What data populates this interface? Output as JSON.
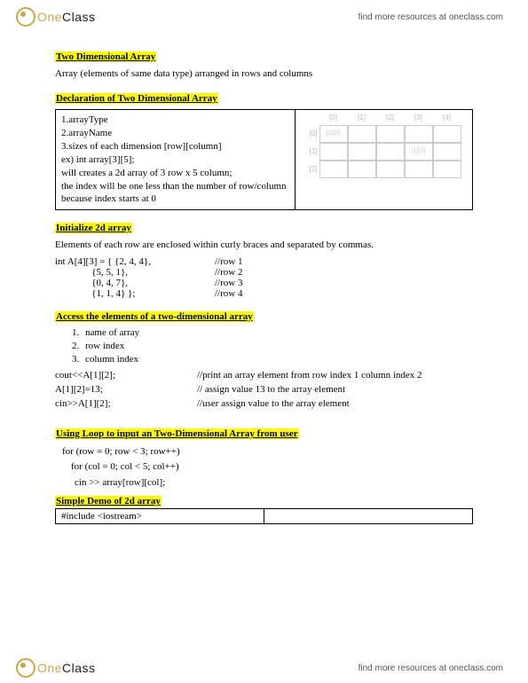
{
  "brand": {
    "one": "One",
    "class": "Class"
  },
  "find_link": "find more resources at oneclass.com",
  "s1": {
    "title": "Two Dimensional Array",
    "desc": "Array (elements of same data type) arranged in rows and columns"
  },
  "s2": {
    "title": "Declaration of Two Dimensional Array",
    "l1": "1.arrayType",
    "l2": "2.arrayName",
    "l3": "3.sizes of each dimension [row][column]",
    "l4": "ex) int array[3][5];",
    "l5": "will creates a 2d array of 3 row x 5 column;",
    "l6": "the index will be one less than the number of row/column because index starts at 0",
    "cols": [
      "[0]",
      "[1]",
      "[2]",
      "[3]",
      "[4]"
    ],
    "rows": [
      "[0]",
      "[1]",
      "[2]"
    ],
    "cell00": "[0][0]",
    "cell13": "[1][3]"
  },
  "s3": {
    "title": "Initialize 2d array",
    "intro": "Elements of each row are enclosed within curly braces and separated by commas.",
    "r1c": "int A[4][3] = { {2, 4, 4},",
    "r1m": "//row 1",
    "r2c": "               {5, 5, 1},",
    "r2m": "//row 2",
    "r3c": "               {0, 4, 7},",
    "r3m": "//row 3",
    "r4c": "               {1, 1, 4} };",
    "r4m": "//row 4"
  },
  "s4": {
    "title": "Access the elements of a two-dimensional array",
    "li1": "name of array",
    "li2": "row index",
    "li3": "column index",
    "a1c": "cout<<A[1][2];",
    "a1m": "//print an array element from row index 1 column index 2",
    "a2c": "A[1][2]=13;",
    "a2m": "// assign value 13 to the array element",
    "a3c": "cin>>A[1][2];",
    "a3m": "//user assign value to the array element"
  },
  "s5": {
    "title": "Using Loop to input an Two-Dimensional Array from user",
    "l1": "for (row = 0; row < 3; row++)",
    "l2": "for (col = 0; col < 5; col++)",
    "l3": "cin >> array[row][col];"
  },
  "s6": {
    "title": "Simple Demo of 2d array",
    "code": "#include <iostream>"
  }
}
